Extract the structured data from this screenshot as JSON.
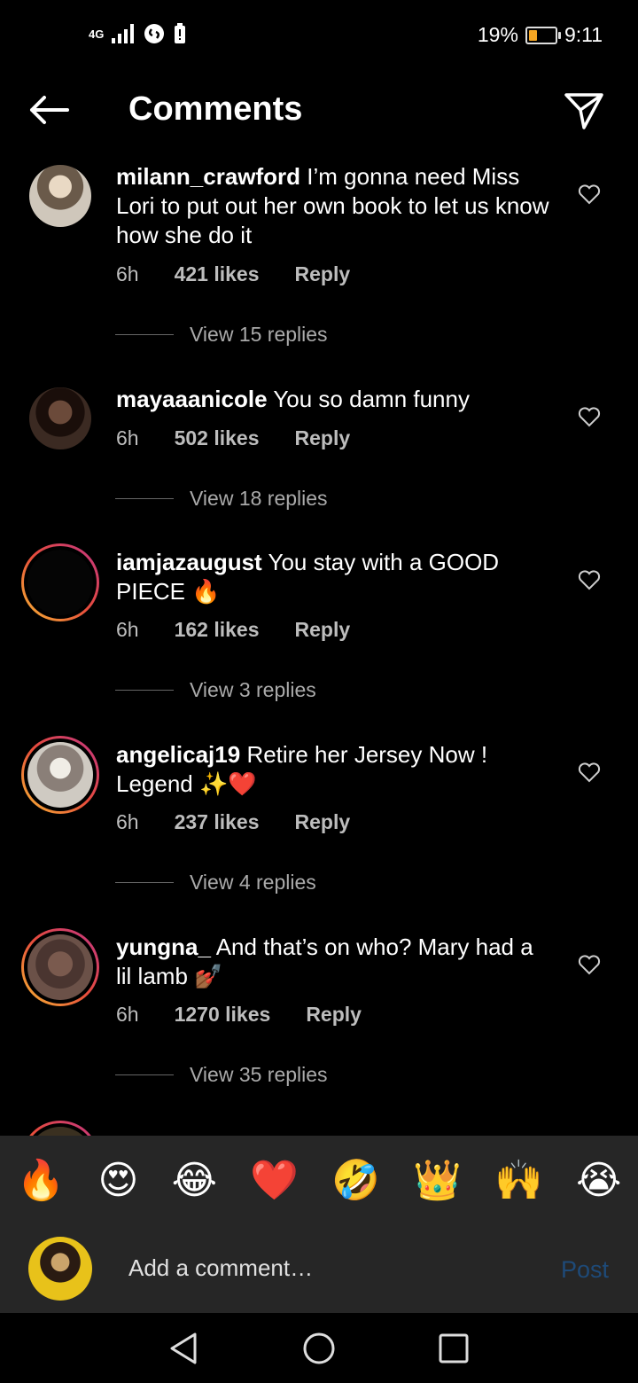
{
  "status_bar": {
    "network": "4G",
    "battery": "19%",
    "battery_level": 0.19,
    "time": "9:11"
  },
  "header": {
    "title": "Comments"
  },
  "comments": [
    {
      "user": "milann_crawford",
      "text": "I’m gonna need Miss Lori to put out her own book to let us know how she do it",
      "time": "6h",
      "likes": "421 likes",
      "reply": "Reply",
      "view_replies": "View 15 replies"
    },
    {
      "user": "mayaaanicole",
      "text": "You so damn funny",
      "time": "6h",
      "likes": "502 likes",
      "reply": "Reply",
      "view_replies": "View 18 replies"
    },
    {
      "user": "iamjazaugust",
      "text": "You stay with a GOOD PIECE 🔥",
      "time": "6h",
      "likes": "162 likes",
      "reply": "Reply",
      "view_replies": "View 3 replies"
    },
    {
      "user": "angelicaj19",
      "text": "Retire her Jersey Now ! Legend ✨❤️",
      "time": "6h",
      "likes": "237 likes",
      "reply": "Reply",
      "view_replies": "View 4 replies"
    },
    {
      "user": "yungna_",
      "text": "And that’s on who? Mary had a lil lamb 💅🏾",
      "time": "6h",
      "likes": "1270 likes",
      "reply": "Reply",
      "view_replies": "View 35 replies"
    }
  ],
  "emoji_bar": [
    "🔥",
    "😍",
    "😂",
    "❤️",
    "🤣",
    "👑",
    "🙌",
    "😭"
  ],
  "comment_input": {
    "placeholder": "Add a comment…",
    "post_label": "Post"
  },
  "colors": {
    "background": "#000000",
    "secondary_text": "#bdbdbd",
    "post_disabled": "#1e4a78",
    "battery_low": "#f5a623"
  }
}
